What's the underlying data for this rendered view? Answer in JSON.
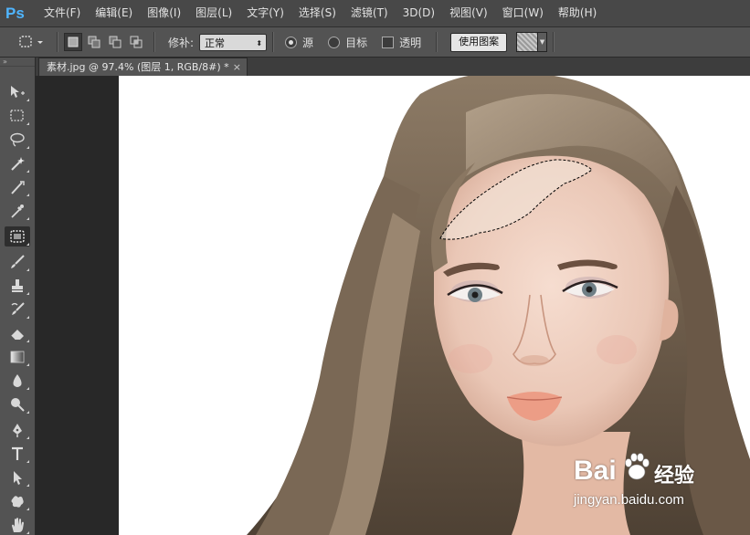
{
  "app": {
    "logo": "Ps"
  },
  "menu": [
    "文件(F)",
    "编辑(E)",
    "图像(I)",
    "图层(L)",
    "文字(Y)",
    "选择(S)",
    "滤镜(T)",
    "3D(D)",
    "视图(V)",
    "窗口(W)",
    "帮助(H)"
  ],
  "options": {
    "patch_label": "修补:",
    "patch_mode": "正常",
    "source_label": "源",
    "target_label": "目标",
    "transparent_label": "透明",
    "use_pattern_button": "使用图案",
    "source_selected": true
  },
  "document": {
    "tab_title": "素材.jpg @ 97.4% (图层 1, RGB/8#) *",
    "close_glyph": "×"
  },
  "tools": [
    "move-icon",
    "marquee-icon",
    "lasso-icon",
    "magic-wand-icon",
    "crop-icon",
    "eyedropper-icon",
    "patch-tool-icon",
    "brush-icon",
    "clone-stamp-icon",
    "history-brush-icon",
    "eraser-icon",
    "gradient-icon",
    "blur-icon",
    "dodge-icon",
    "pen-icon",
    "type-icon",
    "path-selection-icon",
    "custom-shape-icon",
    "hand-icon"
  ],
  "active_tool": "patch-tool-icon",
  "watermark": {
    "brand": "Bai",
    "brand_tail": "经验",
    "url": "jingyan.baidu.com"
  },
  "colors": {
    "ps_blue": "#4fb5ff",
    "menubar": "#484848",
    "panel": "#535353",
    "workspace": "#282828"
  }
}
